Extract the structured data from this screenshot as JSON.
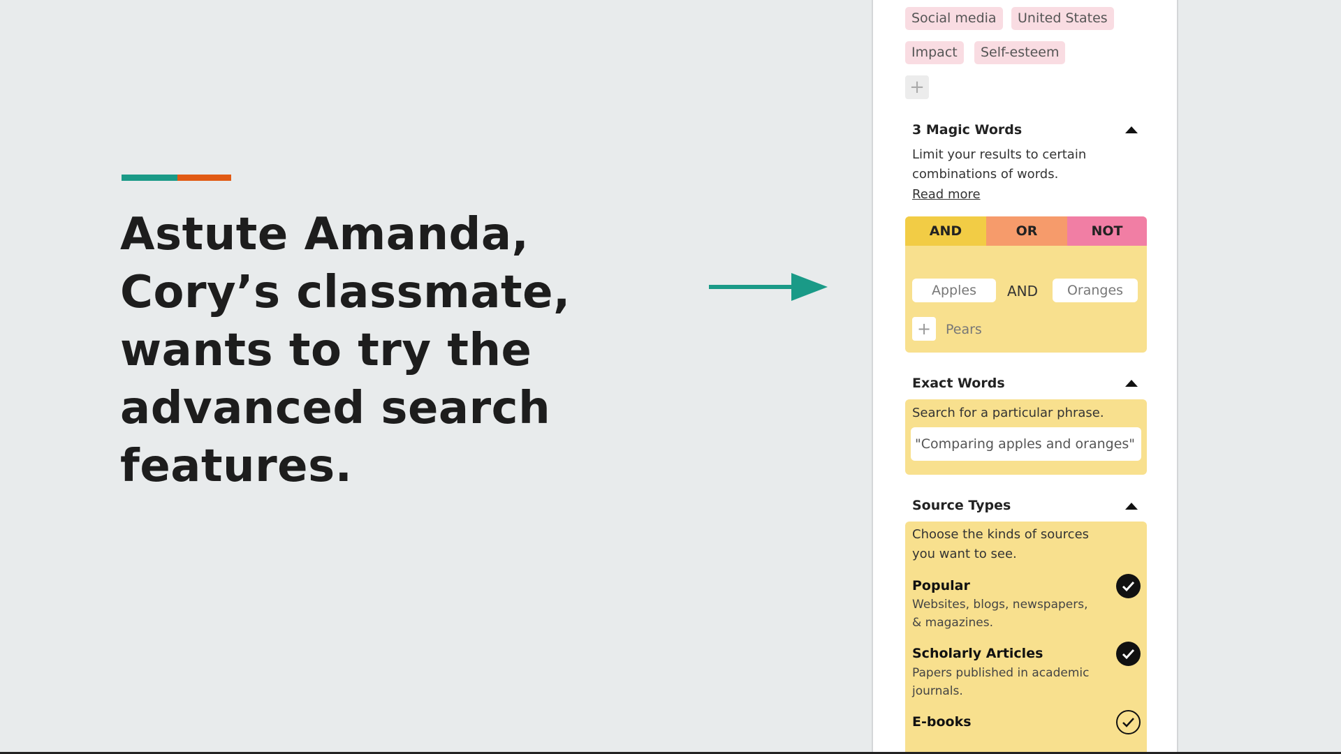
{
  "slide": {
    "headline": "Astute Amanda, Cory’s classmate, wants to try the advanced search features.",
    "accent_colors": [
      "#1a9a87",
      "#e15a14"
    ],
    "arrow_color": "#1a9a87"
  },
  "panel": {
    "tags": [
      "Social media",
      "United States",
      "Impact",
      "Self-esteem"
    ],
    "add_tag_icon": "+",
    "magic_words": {
      "title": "3 Magic Words",
      "description": "Limit your results to certain combinations of words.",
      "read_more": "Read more",
      "tabs": [
        "AND",
        "OR",
        "NOT"
      ],
      "tab_colors": [
        "#f2cc45",
        "#f69b6b",
        "#f17ea4"
      ],
      "word1": "Apples",
      "operator": "AND",
      "word2": "Oranges",
      "add_icon": "+",
      "add_placeholder": "Pears"
    },
    "exact_words": {
      "title": "Exact Words",
      "description": "Search for a particular phrase.",
      "value": "\"Comparing apples and oranges\""
    },
    "source_types": {
      "title": "Source Types",
      "description": "Choose the kinds of sources you want to see.",
      "items": [
        {
          "name": "Popular",
          "desc": "Websites, blogs, newspapers, & magazines.",
          "checked": true
        },
        {
          "name": "Scholarly Articles",
          "desc": "Papers published in academic journals.",
          "checked": true
        },
        {
          "name": "E-books",
          "desc": "",
          "checked": true
        }
      ]
    }
  }
}
